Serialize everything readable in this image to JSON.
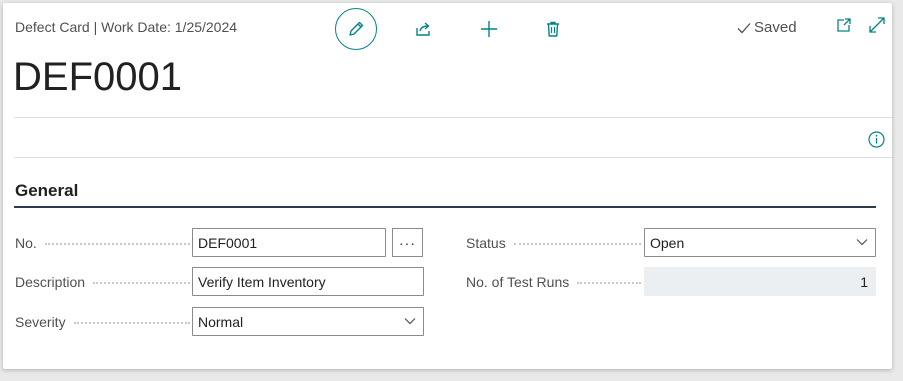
{
  "header": {
    "caption": "Defect Card | Work Date: 1/25/2024",
    "title": "DEF0001",
    "saved_label": "Saved"
  },
  "toolbar": {
    "edit_icon": "pencil-icon",
    "share_icon": "share-icon",
    "new_icon": "plus-icon",
    "delete_icon": "trash-icon"
  },
  "section": {
    "title": "General"
  },
  "fields": {
    "no": {
      "label": "No.",
      "value": "DEF0001",
      "assist_label": "···"
    },
    "description": {
      "label": "Description",
      "value": "Verify Item Inventory"
    },
    "severity": {
      "label": "Severity",
      "value": "Normal"
    },
    "status": {
      "label": "Status",
      "value": "Open"
    },
    "test_runs": {
      "label": "No. of Test Runs",
      "value": "1"
    }
  },
  "colors": {
    "accent": "#008489",
    "section_line": "#2e3b4e",
    "readonly_bg": "#eceff1"
  }
}
